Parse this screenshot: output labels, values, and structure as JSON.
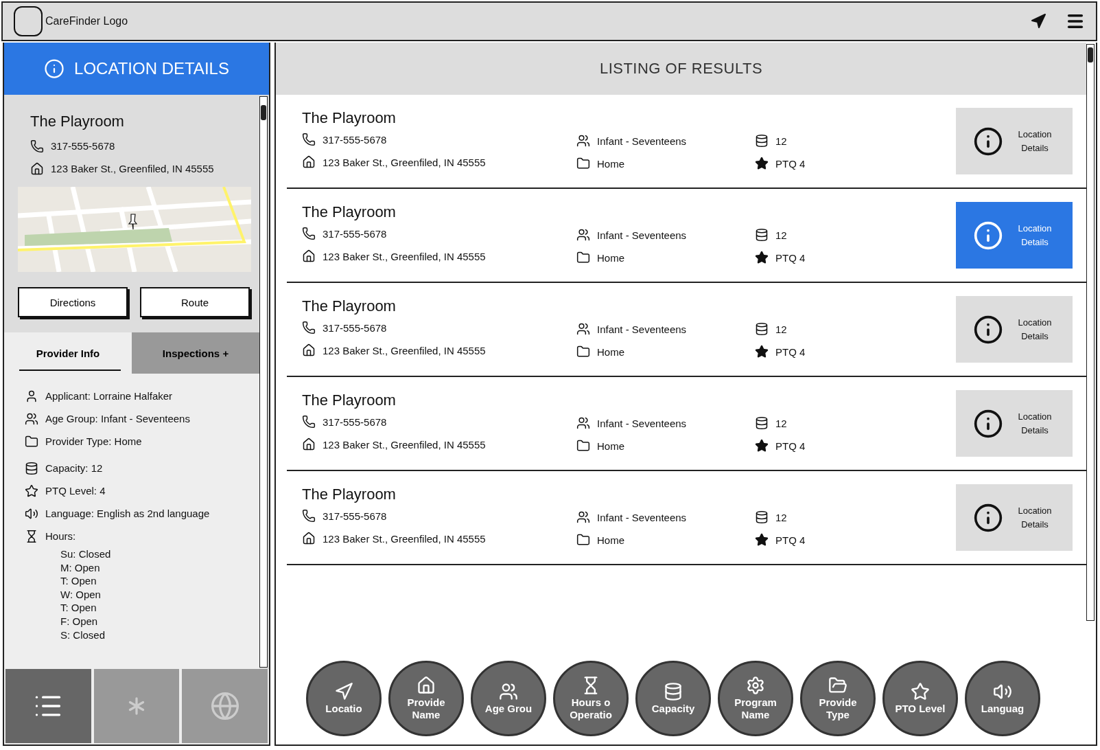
{
  "header": {
    "logo": "CareFinder Logo"
  },
  "details": {
    "title": "LOCATION DETAILS",
    "name": "The Playroom",
    "phone": "317-555-5678",
    "address": "123 Baker St., Greenfiled, IN 45555",
    "buttons": [
      "Directions",
      "Route"
    ]
  },
  "info_tabs": [
    {
      "label": "Provider Info",
      "selected": true
    },
    {
      "label": "Inspections +",
      "selected": false
    }
  ],
  "provider_info": [
    {
      "kind": "applicant",
      "text": "Applicant: Lorraine Halfaker"
    },
    {
      "kind": "age",
      "text": "Age Group:  Infant - Seventeens"
    },
    {
      "kind": "type",
      "text": "Provider Type: Home"
    },
    {
      "kind": "capacity",
      "text": "Capacity: 12"
    },
    {
      "kind": "level",
      "text": "PTQ Level: 4"
    },
    {
      "kind": "language",
      "text": "Language:  English as 2nd language"
    },
    {
      "kind": "hours",
      "text": "Hours:",
      "children": [
        "Su:  Closed",
        "M: Open",
        "T: Open",
        "W: Open",
        "T: Open",
        "F: Open",
        "S: Closed"
      ]
    }
  ],
  "bottom_tabs": [
    {
      "kind": "list",
      "selected": true
    },
    {
      "kind": "asterisk",
      "selected": false
    },
    {
      "kind": "globe",
      "selected": false
    }
  ],
  "results": {
    "title": "LISTING OF RESULTS",
    "rows": [
      {
        "name": "The Playroom",
        "phone": "317-555-5678",
        "address": "123 Baker St., Greenfiled, IN 45555",
        "age": "Infant - Seventeens",
        "type": "Home",
        "capacity": "12",
        "ptq": "PTQ 4",
        "button": "Location Details",
        "selected": false
      },
      {
        "name": "The Playroom",
        "phone": "317-555-5678",
        "address": "123 Baker St., Greenfiled, IN 45555",
        "age": "Infant - Seventeens",
        "type": "Home",
        "capacity": "12",
        "ptq": "PTQ 4",
        "button": "Location Details",
        "selected": true
      },
      {
        "name": "The Playroom",
        "phone": "317-555-5678",
        "address": "123 Baker St., Greenfiled, IN 45555",
        "age": "Infant - Seventeens",
        "type": "Home",
        "capacity": "12",
        "ptq": "PTQ 4",
        "button": "Location Details",
        "selected": false
      },
      {
        "name": "The Playroom",
        "phone": "317-555-5678",
        "address": "123 Baker St., Greenfiled, IN 45555",
        "age": "Infant - Seventeens",
        "type": "Home",
        "capacity": "12",
        "ptq": "PTQ 4",
        "button": "Location Details",
        "selected": false
      },
      {
        "name": "The Playroom",
        "phone": "317-555-5678",
        "address": "123 Baker St., Greenfiled, IN 45555",
        "age": "Infant - Seventeens",
        "type": "Home",
        "capacity": "12",
        "ptq": "PTQ 4",
        "button": "Location Details",
        "selected": false
      }
    ]
  },
  "filters": [
    {
      "kind": "location",
      "label": "Locatio"
    },
    {
      "kind": "name",
      "label": "Provide Name"
    },
    {
      "kind": "age",
      "label": "Age Grou"
    },
    {
      "kind": "hours",
      "label": "Hours o Operatio"
    },
    {
      "kind": "capacity",
      "label": "Capacity"
    },
    {
      "kind": "program",
      "label": "Program Name"
    },
    {
      "kind": "type",
      "label": "Provide Type"
    },
    {
      "kind": "level",
      "label": "PTO Level"
    },
    {
      "kind": "language",
      "label": "Languag"
    }
  ]
}
